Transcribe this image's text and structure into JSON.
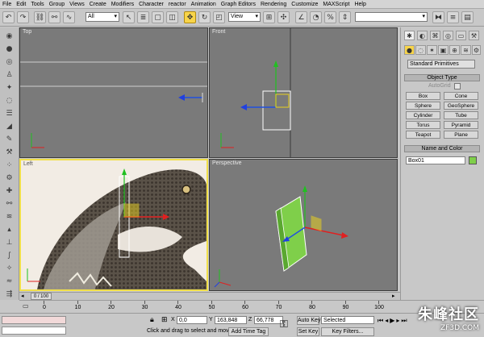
{
  "menubar": {
    "items": [
      "File",
      "Edit",
      "Tools",
      "Group",
      "Views",
      "Create",
      "Modifiers",
      "Character",
      "reactor",
      "Animation",
      "Graph Editors",
      "Rendering",
      "Customize",
      "MAXScript",
      "Help"
    ]
  },
  "toolbar": {
    "selection_filter": "All",
    "ref_coord": "View"
  },
  "viewports": {
    "top_label": "Top",
    "front_label": "Front",
    "left_label": "Left",
    "perspective_label": "Perspective"
  },
  "command_panel": {
    "category_dropdown": "Standard Primitives",
    "object_type_header": "Object Type",
    "autogrid_label": "AutoGrid",
    "buttons": [
      "Box",
      "Cone",
      "Sphere",
      "GeoSphere",
      "Cylinder",
      "Tube",
      "Torus",
      "Pyramid",
      "Teapot",
      "Plane"
    ],
    "name_color_header": "Name and Color",
    "object_name": "Box01",
    "object_color": "#7fcf4a"
  },
  "timeline": {
    "frame_display": "0 / 100",
    "ticks": [
      "0",
      "10",
      "20",
      "30",
      "40",
      "50",
      "60",
      "70",
      "80",
      "90",
      "100"
    ]
  },
  "status": {
    "x_label": "X",
    "x_value": "0,0",
    "y_label": "Y",
    "y_value": "163,848",
    "z_label": "Z",
    "z_value": "66,778",
    "prompt": "Click and drag to select and move",
    "add_time_tag": "Add Time Tag",
    "auto_key": "Auto Key",
    "set_key": "Set Key",
    "key_mode": "Selected",
    "key_filters": "Key Filters..."
  },
  "watermark": {
    "text": "朱峰社区",
    "sub": "ZF3D.COM"
  },
  "colors": {
    "viewport_bg": "#7a7a7a",
    "active_border": "#f1e04a",
    "gizmo_x": "#e02020",
    "gizmo_y": "#20c020",
    "gizmo_z": "#2040e0",
    "box_green": "#7fcf4a"
  }
}
